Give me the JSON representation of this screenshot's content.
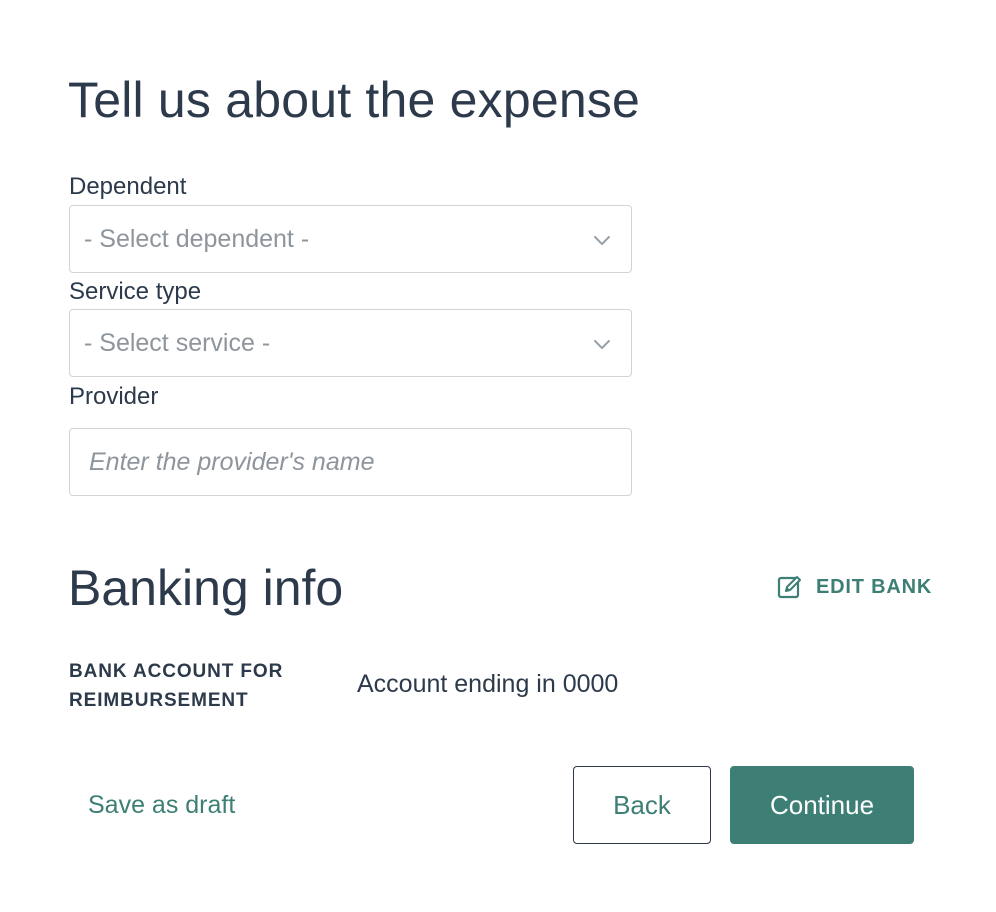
{
  "expense": {
    "title": "Tell us about the expense",
    "dependent": {
      "label": "Dependent",
      "selected": "- Select dependent -"
    },
    "service_type": {
      "label": "Service type",
      "selected": "- Select service -"
    },
    "provider": {
      "label": "Provider",
      "placeholder": "Enter the provider's name",
      "value": ""
    }
  },
  "banking": {
    "title": "Banking info",
    "edit_label": "EDIT BANK",
    "account_label": "BANK ACCOUNT FOR REIMBURSEMENT",
    "account_value": "Account ending in 0000"
  },
  "footer": {
    "save_draft": "Save as draft",
    "back": "Back",
    "continue": "Continue"
  },
  "colors": {
    "accent": "#3d7f75",
    "text": "#2c3a4b",
    "placeholder": "#8e959c",
    "border": "#cfd4d9"
  },
  "icons": {
    "select_chevron": "chevron-down-icon",
    "edit_bank": "edit-icon"
  }
}
